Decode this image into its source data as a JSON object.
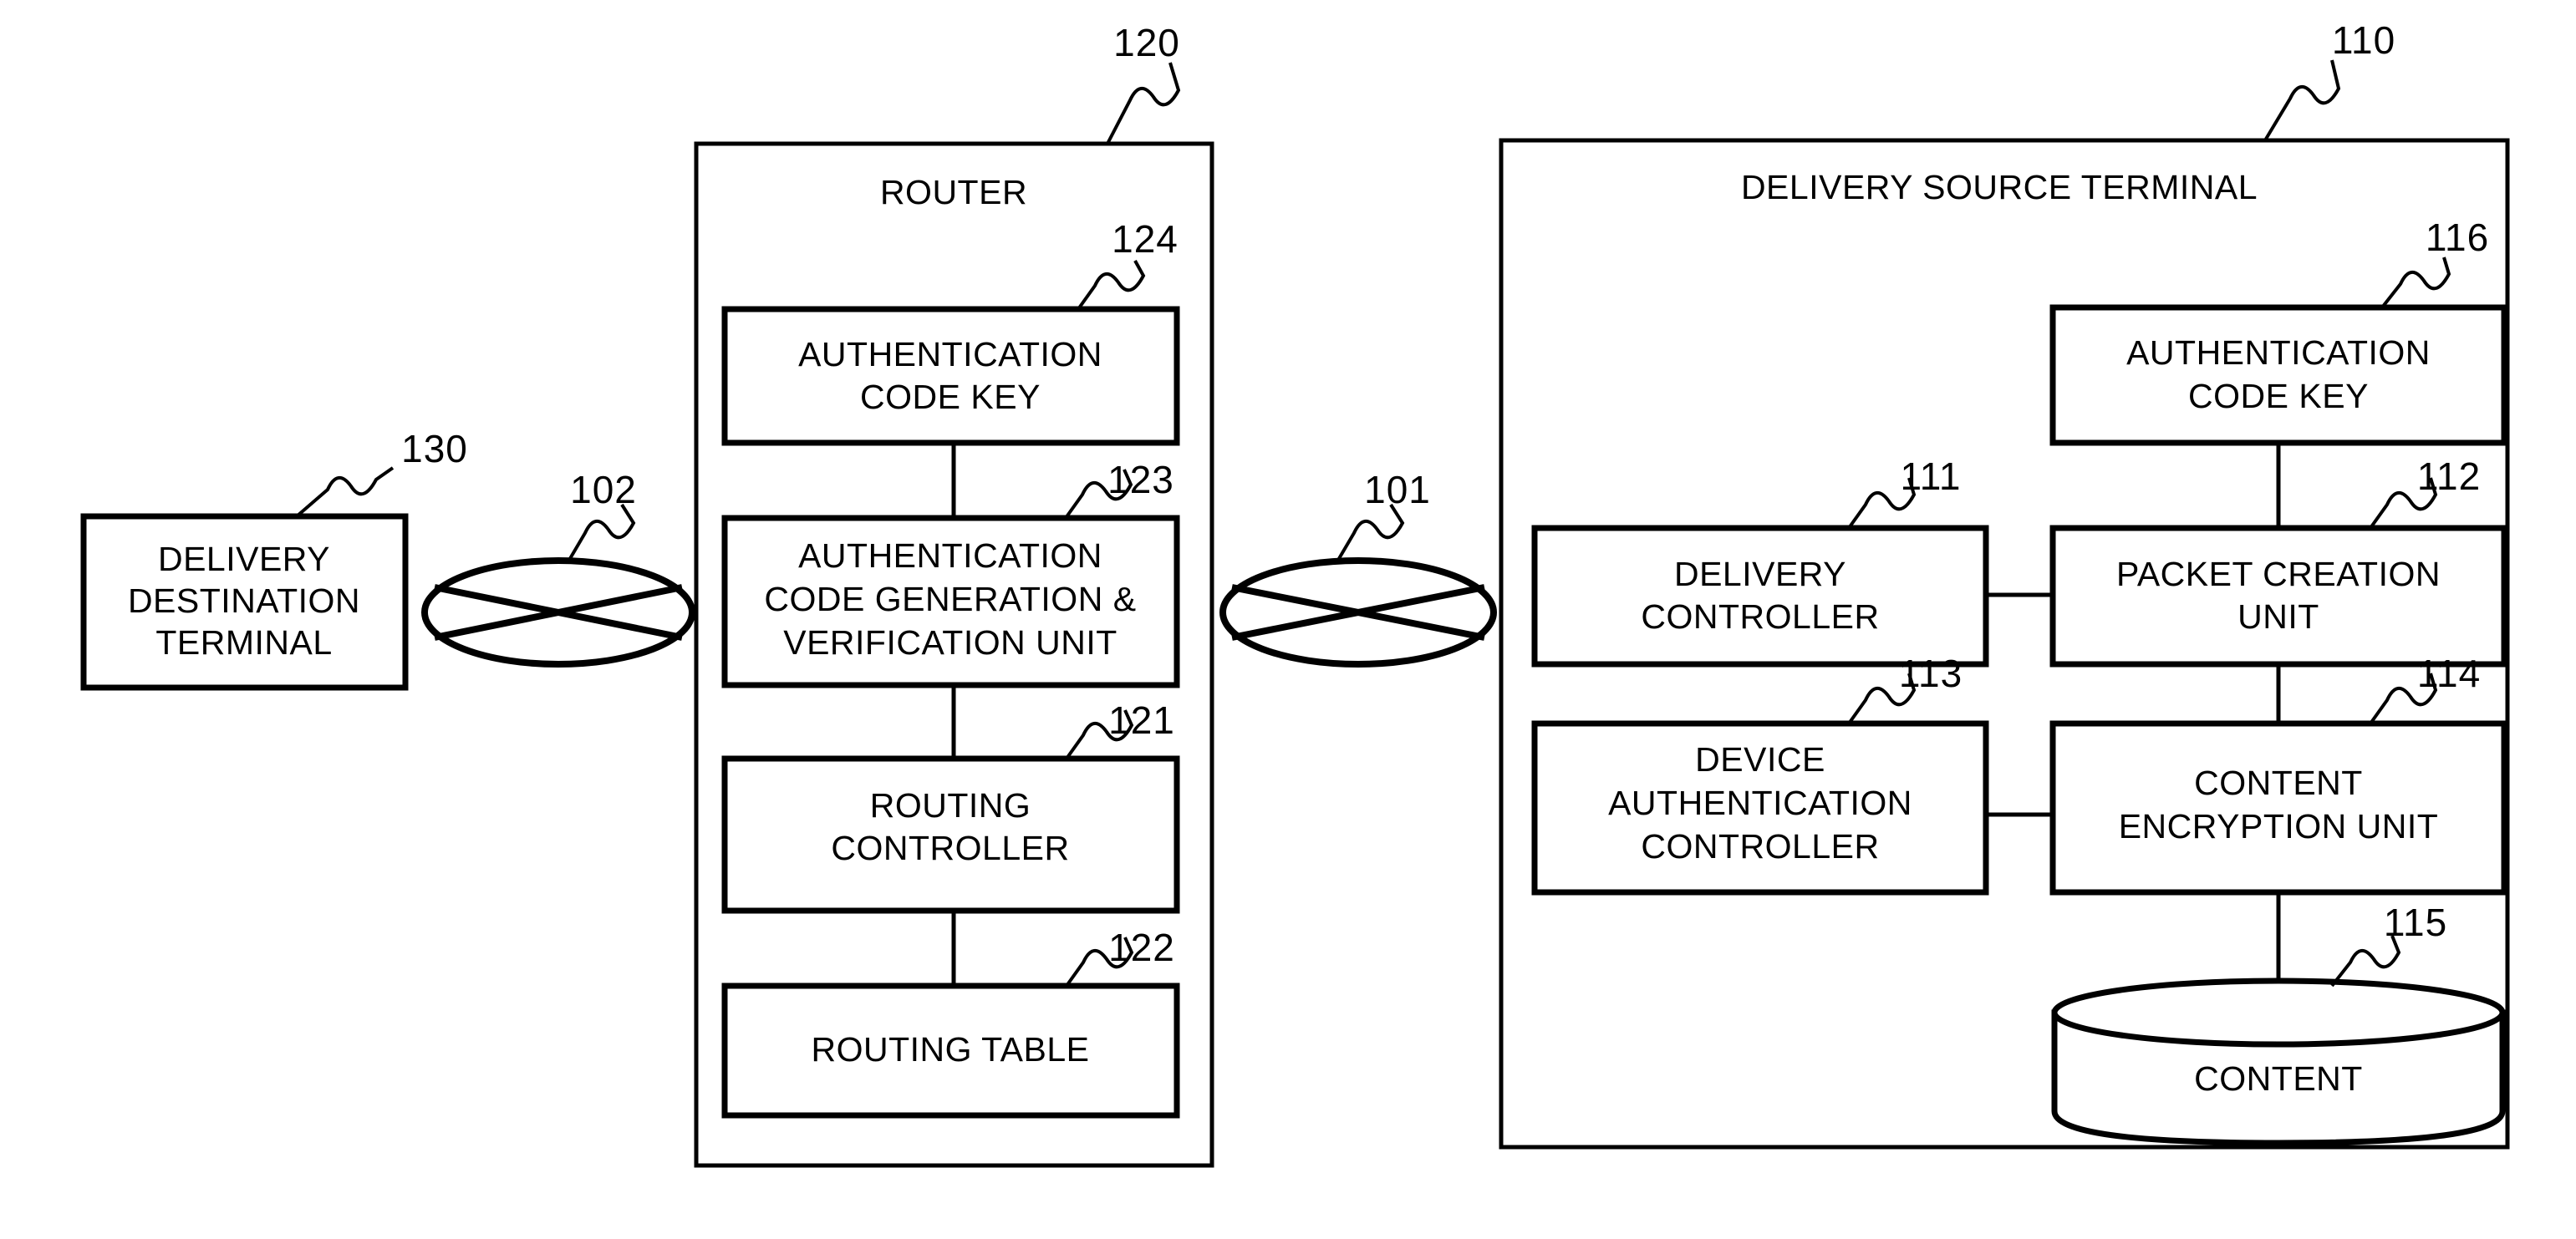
{
  "figure": {
    "title": "Network content delivery block diagram",
    "stroke_color": "#000000",
    "background_color": "#ffffff"
  },
  "nodes": {
    "delivery_destination_terminal": {
      "ref": "130",
      "label_lines": [
        "DELIVERY",
        "DESTINATION",
        "TERMINAL"
      ],
      "line1": "DELIVERY",
      "line2": "DESTINATION",
      "line3": "TERMINAL"
    },
    "network_102": {
      "ref": "102",
      "icon": "network-cloud-icon"
    },
    "network_101": {
      "ref": "101",
      "icon": "network-cloud-icon"
    },
    "router": {
      "ref": "120",
      "label": "ROUTER"
    },
    "router_auth_code_key": {
      "ref": "124",
      "line1": "AUTHENTICATION",
      "line2": "CODE KEY"
    },
    "router_auth_code_gen_verify": {
      "ref": "123",
      "line1": "AUTHENTICATION",
      "line2": "CODE GENERATION &",
      "line3": "VERIFICATION UNIT"
    },
    "routing_controller": {
      "ref": "121",
      "line1": "ROUTING",
      "line2": "CONTROLLER"
    },
    "routing_table": {
      "ref": "122",
      "line1": "ROUTING TABLE"
    },
    "delivery_source_terminal": {
      "ref": "110",
      "label": "DELIVERY SOURCE TERMINAL"
    },
    "source_auth_code_key": {
      "ref": "116",
      "line1": "AUTHENTICATION",
      "line2": "CODE KEY"
    },
    "delivery_controller": {
      "ref": "111",
      "line1": "DELIVERY",
      "line2": "CONTROLLER"
    },
    "packet_creation_unit": {
      "ref": "112",
      "line1": "PACKET CREATION",
      "line2": "UNIT"
    },
    "device_authentication_controller": {
      "ref": "113",
      "line1": "DEVICE",
      "line2": "AUTHENTICATION",
      "line3": "CONTROLLER"
    },
    "content_encryption_unit": {
      "ref": "114",
      "line1": "CONTENT",
      "line2": "ENCRYPTION UNIT"
    },
    "content_store": {
      "ref": "115",
      "label": "CONTENT",
      "icon": "database-cylinder-icon"
    }
  }
}
